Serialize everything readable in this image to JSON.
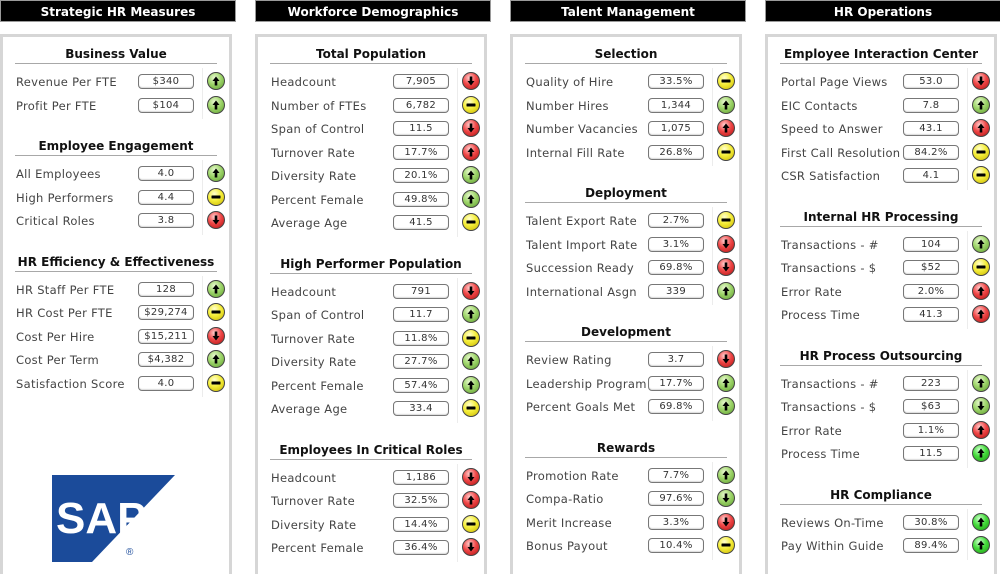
{
  "colors": {
    "header_bg": "#000000",
    "header_text": "#ffffff",
    "panel_border": "#d6d6d6",
    "status_green": "#8cc85a",
    "status_yellow": "#f0e830",
    "status_red": "#e03030",
    "sap_blue": "#1b4b9a"
  },
  "columns": [
    {
      "title": "Strategic HR Measures",
      "sections": [
        {
          "title": "Business Value",
          "rows": [
            {
              "label": "Revenue Per FTE",
              "value": "$340",
              "status": "green",
              "trend": "up"
            },
            {
              "label": "Profit Per FTE",
              "value": "$104",
              "status": "green",
              "trend": "up"
            }
          ]
        },
        {
          "title": "Employee Engagement",
          "rows": [
            {
              "label": "All Employees",
              "value": "4.0",
              "status": "green",
              "trend": "up"
            },
            {
              "label": "High Performers",
              "value": "4.4",
              "status": "yellow",
              "trend": "flat"
            },
            {
              "label": "Critical Roles",
              "value": "3.8",
              "status": "red",
              "trend": "down"
            }
          ]
        },
        {
          "title": "HR Efficiency & Effectiveness",
          "rows": [
            {
              "label": "HR Staff Per FTE",
              "value": "128",
              "status": "green",
              "trend": "up"
            },
            {
              "label": "HR Cost Per FTE",
              "value": "$29,274",
              "status": "yellow",
              "trend": "flat"
            },
            {
              "label": "Cost Per Hire",
              "value": "$15,211",
              "status": "red",
              "trend": "down"
            },
            {
              "label": "Cost Per Term",
              "value": "$4,382",
              "status": "green",
              "trend": "up"
            },
            {
              "label": "Satisfaction Score",
              "value": "4.0",
              "status": "yellow",
              "trend": "flat"
            }
          ]
        }
      ],
      "logo": {
        "text": "SAP",
        "mark": "®"
      }
    },
    {
      "title": "Workforce Demographics",
      "sections": [
        {
          "title": "Total Population",
          "rows": [
            {
              "label": "Headcount",
              "value": "7,905",
              "status": "red",
              "trend": "down"
            },
            {
              "label": "Number of FTEs",
              "value": "6,782",
              "status": "yellow",
              "trend": "flat"
            },
            {
              "label": "Span of Control",
              "value": "11.5",
              "status": "red",
              "trend": "down"
            },
            {
              "label": "Turnover Rate",
              "value": "17.7%",
              "status": "red",
              "trend": "up"
            },
            {
              "label": "Diversity Rate",
              "value": "20.1%",
              "status": "green",
              "trend": "up"
            },
            {
              "label": "Percent Female",
              "value": "49.8%",
              "status": "green",
              "trend": "up"
            },
            {
              "label": "Average Age",
              "value": "41.5",
              "status": "yellow",
              "trend": "flat"
            }
          ]
        },
        {
          "title": "High Performer Population",
          "rows": [
            {
              "label": "Headcount",
              "value": "791",
              "status": "red",
              "trend": "down"
            },
            {
              "label": "Span of Control",
              "value": "11.7",
              "status": "green",
              "trend": "up"
            },
            {
              "label": "Turnover Rate",
              "value": "11.8%",
              "status": "yellow",
              "trend": "flat"
            },
            {
              "label": "Diversity Rate",
              "value": "27.7%",
              "status": "green",
              "trend": "up"
            },
            {
              "label": "Percent Female",
              "value": "57.4%",
              "status": "green",
              "trend": "up"
            },
            {
              "label": "Average Age",
              "value": "33.4",
              "status": "yellow",
              "trend": "flat"
            }
          ]
        },
        {
          "title": "Employees In Critical Roles",
          "rows": [
            {
              "label": "Headcount",
              "value": "1,186",
              "status": "red",
              "trend": "down"
            },
            {
              "label": "Turnover Rate",
              "value": "32.5%",
              "status": "red",
              "trend": "up"
            },
            {
              "label": "Diversity Rate",
              "value": "14.4%",
              "status": "yellow",
              "trend": "flat"
            },
            {
              "label": "Percent Female",
              "value": "36.4%",
              "status": "red",
              "trend": "down"
            }
          ]
        }
      ]
    },
    {
      "title": "Talent Management",
      "sections": [
        {
          "title": "Selection",
          "rows": [
            {
              "label": "Quality of Hire",
              "value": "33.5%",
              "status": "yellow",
              "trend": "flat"
            },
            {
              "label": "Number Hires",
              "value": "1,344",
              "status": "green",
              "trend": "up"
            },
            {
              "label": "Number Vacancies",
              "value": "1,075",
              "status": "red",
              "trend": "up"
            },
            {
              "label": "Internal Fill Rate",
              "value": "26.8%",
              "status": "yellow",
              "trend": "flat"
            }
          ]
        },
        {
          "title": "Deployment",
          "rows": [
            {
              "label": "Talent Export Rate",
              "value": "2.7%",
              "status": "yellow",
              "trend": "flat"
            },
            {
              "label": "Talent Import Rate",
              "value": "3.1%",
              "status": "red",
              "trend": "down"
            },
            {
              "label": "Succession Ready",
              "value": "69.8%",
              "status": "red",
              "trend": "down"
            },
            {
              "label": "International Asgn",
              "value": "339",
              "status": "green",
              "trend": "up"
            }
          ]
        },
        {
          "title": "Development",
          "rows": [
            {
              "label": "Review Rating",
              "value": "3.7",
              "status": "red",
              "trend": "down"
            },
            {
              "label": "Leadership Program",
              "value": "17.7%",
              "status": "green",
              "trend": "up"
            },
            {
              "label": "Percent Goals Met",
              "value": "69.8%",
              "status": "green",
              "trend": "up"
            }
          ]
        },
        {
          "title": "Rewards",
          "rows": [
            {
              "label": "Promotion Rate",
              "value": "7.7%",
              "status": "green",
              "trend": "up"
            },
            {
              "label": "Compa-Ratio",
              "value": "97.6%",
              "status": "green",
              "trend": "down"
            },
            {
              "label": "Merit Increase",
              "value": "3.3%",
              "status": "red",
              "trend": "down"
            },
            {
              "label": "Bonus Payout",
              "value": "10.4%",
              "status": "yellow",
              "trend": "flat"
            }
          ]
        }
      ]
    },
    {
      "title": "HR Operations",
      "sections": [
        {
          "title": "Employee Interaction Center",
          "rows": [
            {
              "label": "Portal Page Views",
              "value": "53.0",
              "status": "red",
              "trend": "down"
            },
            {
              "label": "EIC Contacts",
              "value": "7.8",
              "status": "green",
              "trend": "up"
            },
            {
              "label": "Speed to Answer",
              "value": "43.1",
              "status": "red",
              "trend": "up"
            },
            {
              "label": "First Call Resolution",
              "value": "84.2%",
              "status": "yellow",
              "trend": "flat"
            },
            {
              "label": "CSR Satisfaction",
              "value": "4.1",
              "status": "yellow",
              "trend": "flat"
            }
          ]
        },
        {
          "title": "Internal HR Processing",
          "rows": [
            {
              "label": "Transactions - #",
              "value": "104",
              "status": "green",
              "trend": "up"
            },
            {
              "label": "Transactions - $",
              "value": "$52",
              "status": "yellow",
              "trend": "flat"
            },
            {
              "label": "Error Rate",
              "value": "2.0%",
              "status": "red",
              "trend": "up"
            },
            {
              "label": "Process Time",
              "value": "41.3",
              "status": "red",
              "trend": "up"
            }
          ]
        },
        {
          "title": "HR Process Outsourcing",
          "rows": [
            {
              "label": "Transactions - #",
              "value": "223",
              "status": "green",
              "trend": "up"
            },
            {
              "label": "Transactions - $",
              "value": "$63",
              "status": "green",
              "trend": "down"
            },
            {
              "label": "Error Rate",
              "value": "1.1%",
              "status": "red",
              "trend": "up"
            },
            {
              "label": "Process Time",
              "value": "11.5",
              "status": "bright-green",
              "trend": "up"
            }
          ]
        },
        {
          "title": "HR Compliance",
          "rows": [
            {
              "label": "Reviews On-Time",
              "value": "30.8%",
              "status": "bright-green",
              "trend": "up"
            },
            {
              "label": "Pay Within Guide",
              "value": "89.4%",
              "status": "bright-green",
              "trend": "up"
            }
          ]
        }
      ]
    }
  ]
}
